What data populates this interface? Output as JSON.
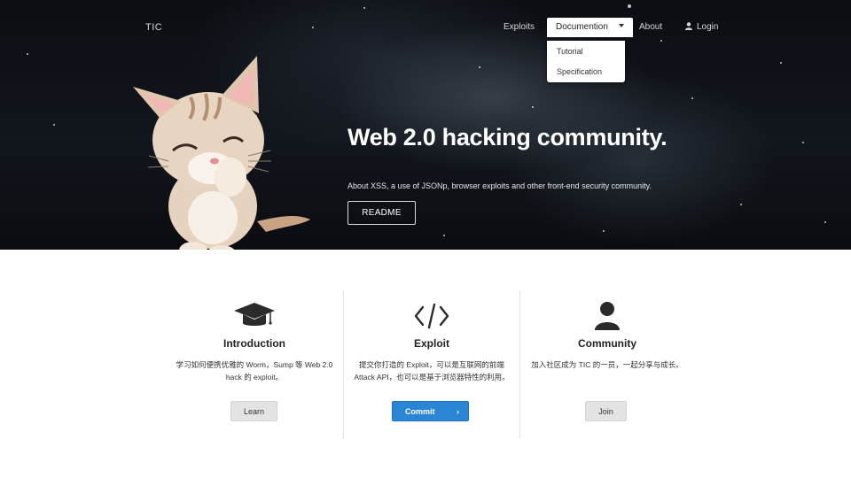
{
  "brand": "TIC",
  "nav": {
    "exploits": "Exploits",
    "documentation": "Documention",
    "about": "About",
    "login": "Login",
    "dropdown": [
      "Tutorial",
      "Specification"
    ]
  },
  "hero": {
    "headline": "Web 2.0 hacking community.",
    "subtitle": "About XSS, a use of JSONp, browser exploits and other front-end security community.",
    "readme_label": "README"
  },
  "features": [
    {
      "title": "Introduction",
      "description": "学习如何便携优雅的 Worm，Sump 等 Web 2.0 hack 的 exploit。",
      "button": "Learn",
      "icon": "graduation-cap-icon"
    },
    {
      "title": "Exploit",
      "description": "提交你打造的 Exploit，可以是互联网的前端 Attack API，也可以是基于浏览器特性的利用。",
      "button": "Commit",
      "icon": "code-icon"
    },
    {
      "title": "Community",
      "description": "加入社区成为 TIC 的一员，一起分享与成长。",
      "button": "Join",
      "icon": "user-icon"
    }
  ],
  "colors": {
    "accent": "#2a85d5",
    "hero_bg": "#0b0d12"
  }
}
